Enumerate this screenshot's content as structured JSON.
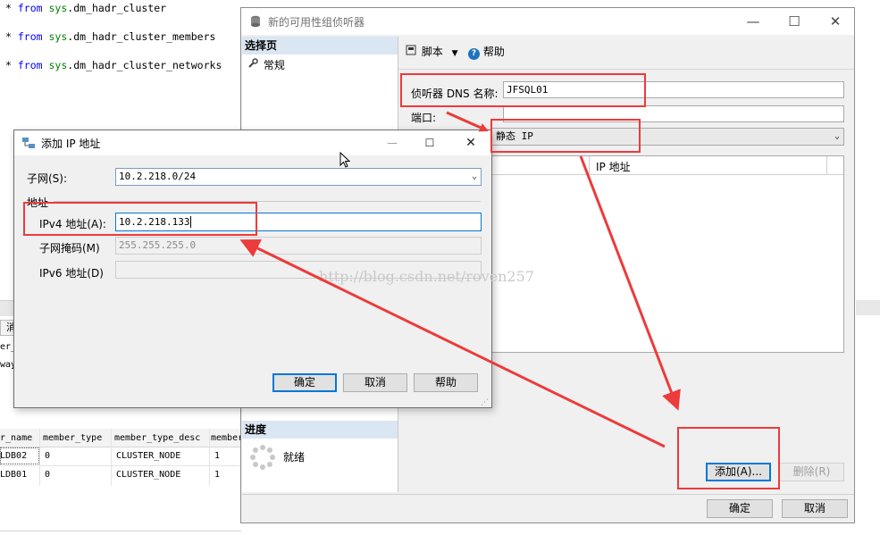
{
  "editor": {
    "lines": [
      {
        "prefix": "* ",
        "kw": "from",
        "schema": "sys",
        "obj": ".dm_hadr_cluster"
      },
      {
        "prefix": "* ",
        "kw": "from",
        "schema": "sys",
        "obj": ".dm_hadr_cluster_members"
      },
      {
        "prefix": "* ",
        "kw": "from",
        "schema": "sys",
        "obj": ".dm_hadr_cluster_networks"
      }
    ],
    "tab_fragment": "消",
    "left_fragments": [
      "er_",
      "way"
    ]
  },
  "results": {
    "headers": [
      "r_name",
      "member_type",
      "member_type_desc",
      "member"
    ],
    "rows": [
      [
        "LDB02",
        "0",
        "CLUSTER_NODE",
        "1"
      ],
      [
        "LDB01",
        "0",
        "CLUSTER_NODE",
        "1"
      ]
    ]
  },
  "listener_dialog": {
    "title": "新的可用性组侦听器",
    "select_page": "选择页",
    "pages": [
      {
        "label": "常规",
        "icon": "wrench-icon"
      }
    ],
    "toolbar": {
      "script": "脚本",
      "help": "帮助"
    },
    "dns_label": "侦听器 DNS 名称:",
    "dns_value": "JFSQL01",
    "port_label": "端口:",
    "port_value": "",
    "network_mode": "静态 IP",
    "grid_headers": [
      "",
      "IP 地址"
    ],
    "progress_head": "进度",
    "progress_status": "就绪",
    "add_button": "添加(A)...",
    "remove_button": "删除(R)",
    "ok_button": "确定",
    "cancel_button": "取消"
  },
  "addip_dialog": {
    "title": "添加 IP 地址",
    "subnet_label": "子网(S):",
    "subnet_value": "10.2.218.0/24",
    "address_group": "地址",
    "ipv4_label": "IPv4 地址(A):",
    "ipv4_value": "10.2.218.133",
    "mask_label": "子网掩码(M)",
    "mask_value": "255.255.255.0",
    "ipv6_label": "IPv6 地址(D)",
    "ipv6_value": "",
    "ok_button": "确定",
    "cancel_button": "取消",
    "help_button": "帮助"
  },
  "watermark": "http://blog.csdn.net/roven257",
  "colors": {
    "annotation": "#ec3b3b",
    "keyword": "#0000ff",
    "schema": "#008000",
    "section_head": "#dbe6f3"
  }
}
